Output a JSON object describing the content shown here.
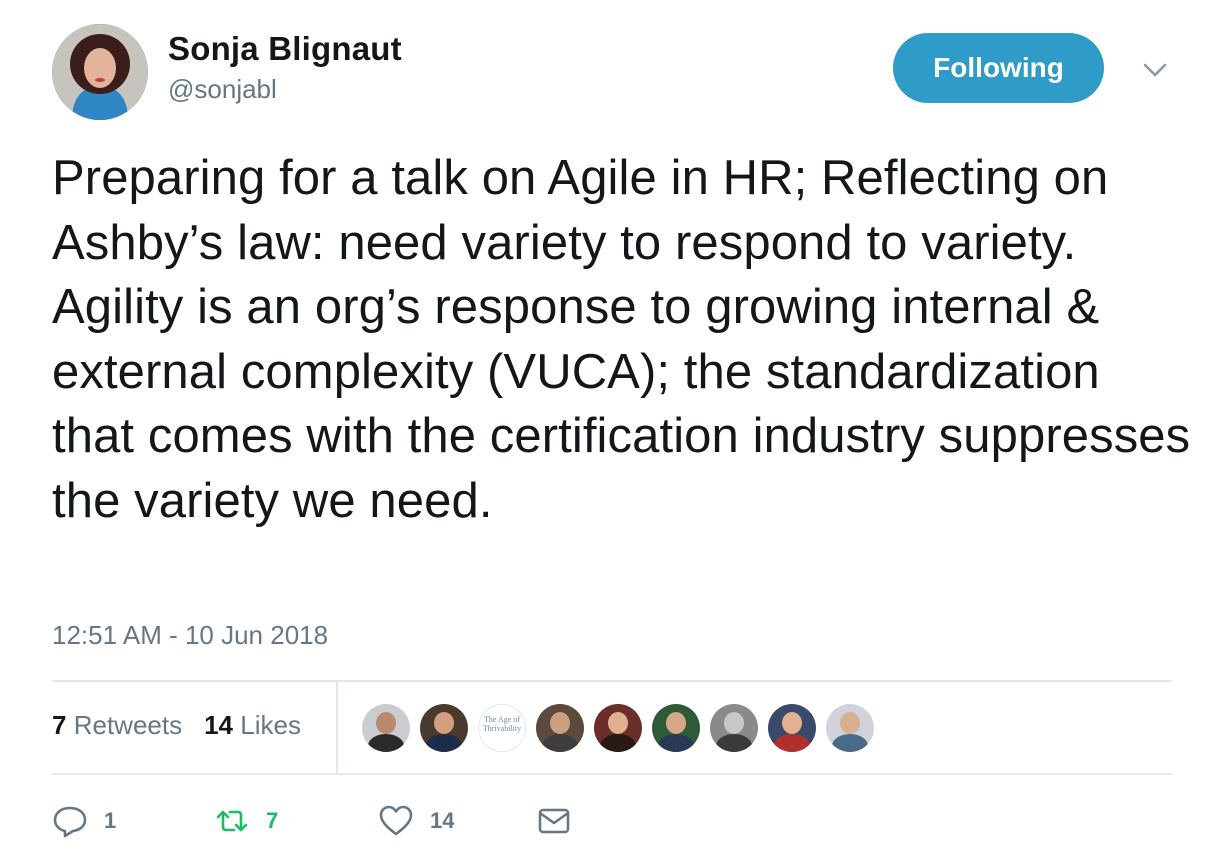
{
  "user": {
    "name": "Sonja Blignaut",
    "handle": "@sonjabl"
  },
  "follow_button": {
    "label": "Following"
  },
  "tweet": {
    "text": "Preparing for a talk on Agile in HR; Reflecting on Ashby’s law: need variety to respond to variety. Agility is an org’s response to growing internal & external complexity (VUCA); the standardization that comes with the certification industry suppresses the variety we need.",
    "timestamp": "12:51 AM - 10 Jun 2018"
  },
  "stats": {
    "retweets_count": "7",
    "retweets_label": "Retweets",
    "likes_count": "14",
    "likes_label": "Likes"
  },
  "likers": [
    {
      "kind": "photo",
      "bg": "#c9ccd0",
      "face": "#b98a6e",
      "body": "#2b2b2b"
    },
    {
      "kind": "photo",
      "bg": "#4a3a2e",
      "face": "#d2a07c",
      "body": "#1d2c4a"
    },
    {
      "kind": "logo",
      "text": "The Age of Thrivability"
    },
    {
      "kind": "photo",
      "bg": "#5c4b3c",
      "face": "#caa080",
      "body": "#3d3d3d"
    },
    {
      "kind": "photo",
      "bg": "#6b2e2a",
      "face": "#e0b090",
      "body": "#2a1a16"
    },
    {
      "kind": "photo",
      "bg": "#2f5a3a",
      "face": "#d8a886",
      "body": "#2a3a56"
    },
    {
      "kind": "photo",
      "bg": "#8a8a8a",
      "face": "#c8c8c8",
      "body": "#3a3a3a"
    },
    {
      "kind": "photo",
      "bg": "#3a4a6a",
      "face": "#e2b290",
      "body": "#b03030"
    },
    {
      "kind": "photo",
      "bg": "#d0d4da",
      "face": "#d8b090",
      "body": "#4a6a8a"
    }
  ],
  "actions": {
    "reply_count": "1",
    "retweet_count": "7",
    "like_count": "14"
  },
  "colors": {
    "follow_button": "#2f9bc9",
    "secondary_text": "#657786",
    "retweet_green": "#17bf63"
  }
}
